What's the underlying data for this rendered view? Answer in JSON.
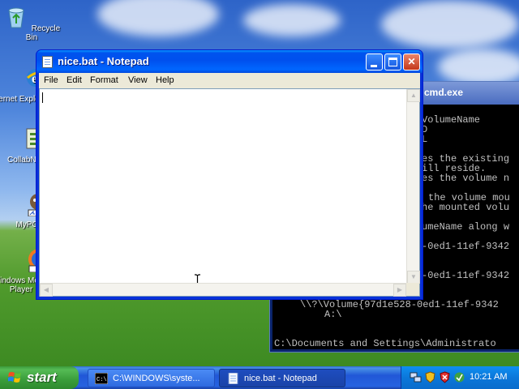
{
  "desktop": {
    "icons": [
      {
        "label": "Recycle Bin",
        "icon": "recycle-bin-icon"
      },
      {
        "label": "Internet Explorer",
        "icon": "internet-explorer-icon"
      },
      {
        "label": "CollabNet",
        "icon": "collabnet-icon"
      },
      {
        "label": "MyPC",
        "icon": "my-computer-icon"
      },
      {
        "label": "Windows Media Player",
        "icon": "media-player-icon"
      }
    ]
  },
  "cmd_window": {
    "title": "cmd.exe",
    "lines": [
      "VolumeName",
      "D",
      "L",
      "es the existing",
      "ill reside.",
      "es the volume n",
      "the volume mou",
      "he mounted volu",
      "umeName along w",
      "-0ed1-11ef-9342",
      "-0ed1-11ef-9342",
      "\\\\?\\Volume{97d1e528-0ed1-11ef-9342",
      "A:\\",
      "C:\\Documents and Settings\\Administrato"
    ]
  },
  "notepad": {
    "title": "nice.bat - Notepad",
    "menu": [
      "File",
      "Edit",
      "Format",
      "View",
      "Help"
    ],
    "content": ""
  },
  "taskbar": {
    "start_label": "start",
    "tasks": [
      {
        "label": "C:\\WINDOWS\\syste...",
        "icon": "cmd-icon",
        "active": false
      },
      {
        "label": "nice.bat - Notepad",
        "icon": "notepad-icon",
        "active": true
      }
    ],
    "clock": "10:21 AM"
  },
  "colors": {
    "title_bar": "#0053ee",
    "taskbar": "#2157d7",
    "start_button": "#3a9d3a",
    "close_button": "#c4371a"
  }
}
